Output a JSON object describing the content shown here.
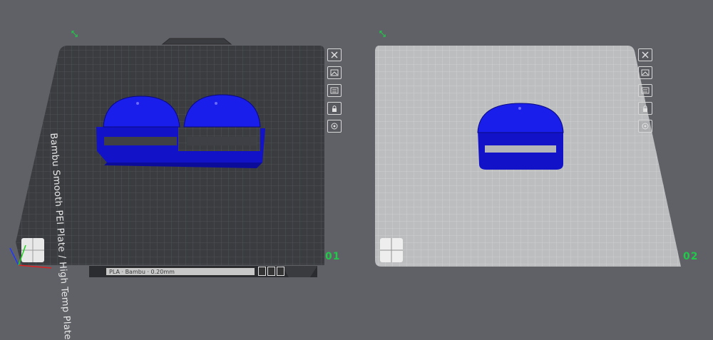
{
  "plates": [
    {
      "index_label": "01",
      "bed_name": "Bambu Smooth PEI Plate / High Temp Plate",
      "corner_glyph": "⤡",
      "status_strip_text": "PLA · Bambu · 0.20mm",
      "tools": [
        "close-icon",
        "auto-orient-icon",
        "arrange-icon",
        "lock-icon",
        "settings-icon"
      ]
    },
    {
      "index_label": "02",
      "corner_glyph": "⤡",
      "tools": [
        "close-icon",
        "auto-orient-icon",
        "arrange-icon",
        "lock-icon",
        "settings-icon"
      ]
    }
  ],
  "colors": {
    "background": "#5f6166",
    "plate_dark": "#3b3c40",
    "plate_light": "#bcbdbf",
    "model_blue": "#1a1eea",
    "label_green": "#20c94a"
  }
}
